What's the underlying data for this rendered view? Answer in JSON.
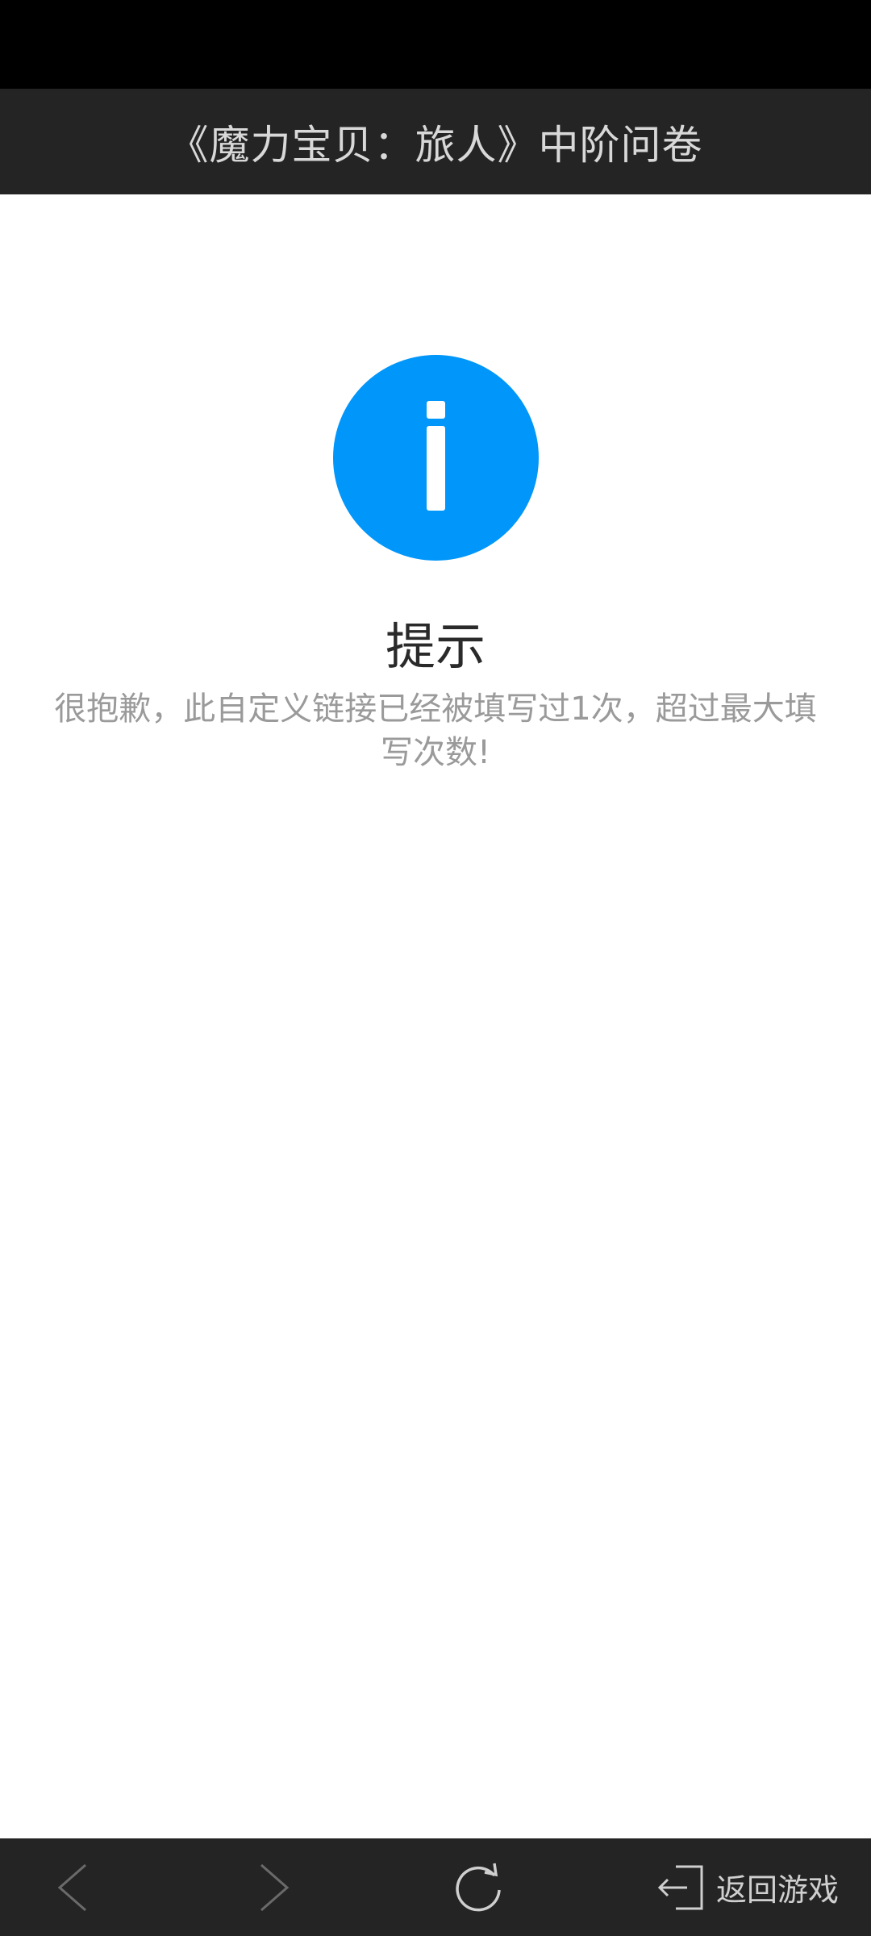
{
  "header": {
    "title": "《魔力宝贝：旅人》中阶问卷"
  },
  "notice": {
    "icon": "info-icon",
    "title": "提示",
    "message": "很抱歉，此自定义链接已经被填写过1次，超过最大填写次数!"
  },
  "bottom_nav": {
    "back_icon": "chevron-left-icon",
    "forward_icon": "chevron-right-icon",
    "refresh_icon": "refresh-icon",
    "return_icon": "exit-icon",
    "return_label": "返回游戏"
  },
  "colors": {
    "accent": "#0096fa",
    "bar_background": "#242424",
    "status_bar": "#000000"
  }
}
